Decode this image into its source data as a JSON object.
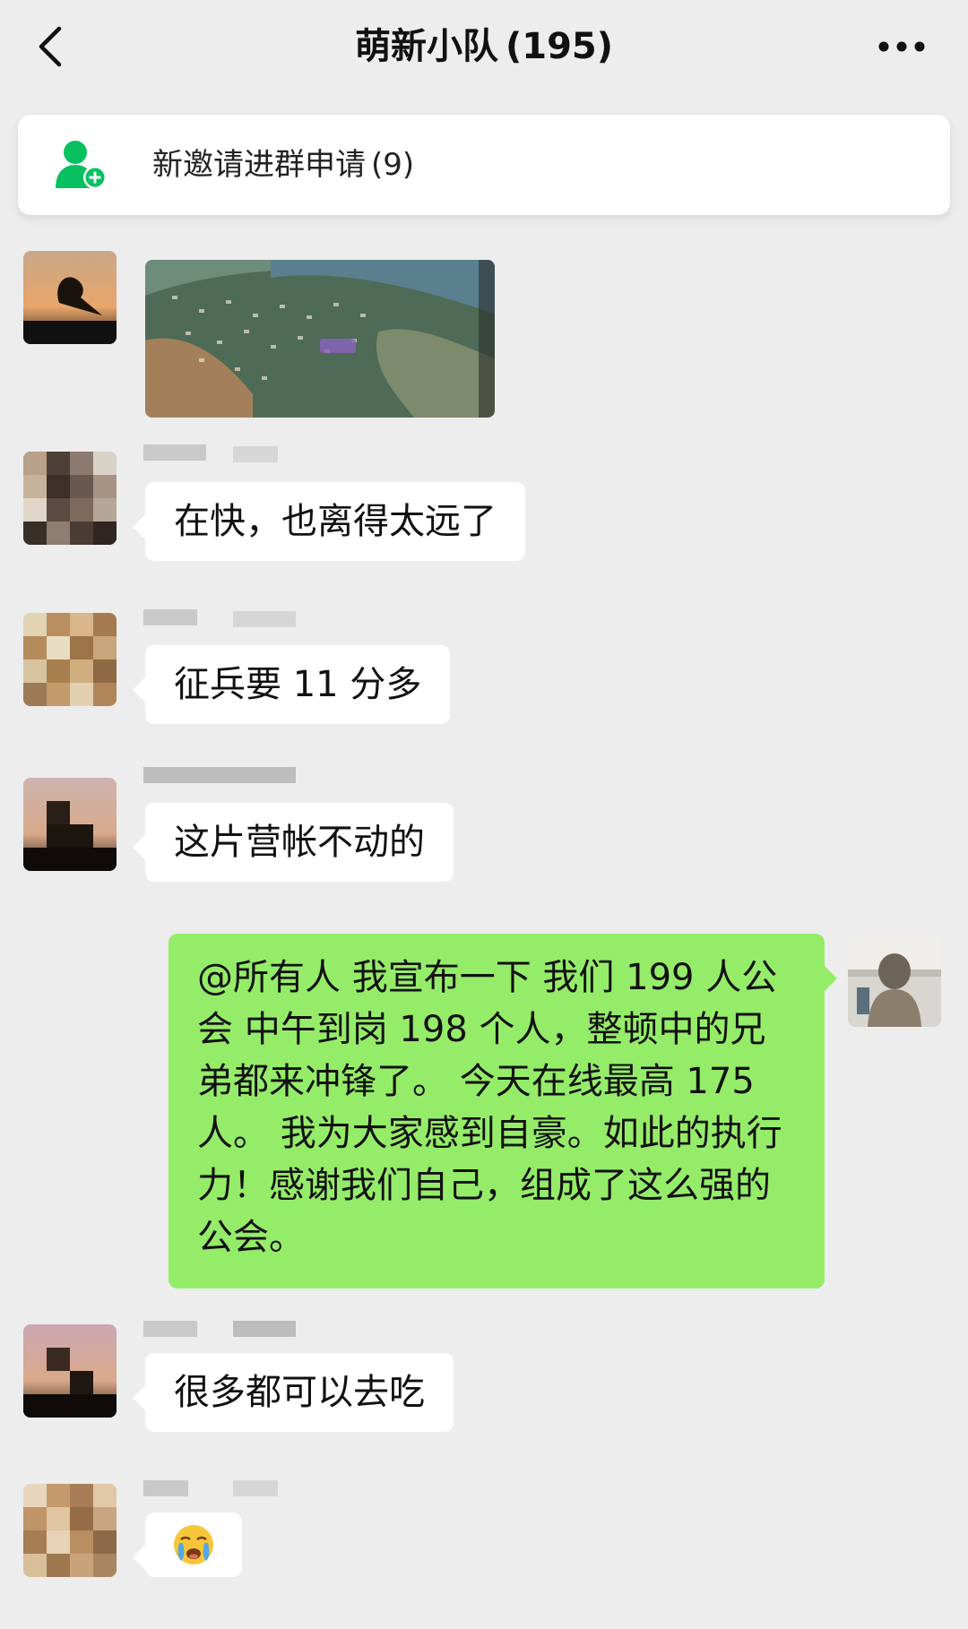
{
  "header": {
    "title": "萌新小队",
    "member_count": "(195)",
    "back_icon": "chevron-left-icon",
    "more_icon": "more-dots-icon"
  },
  "notice": {
    "icon": "add-member-icon",
    "text": "新邀请进群申请",
    "count": "(9)",
    "color": "#07c160"
  },
  "messages": [
    {
      "type": "image",
      "content_desc": "map"
    },
    {
      "type": "text",
      "side": "left",
      "text": "在快，也离得太远了"
    },
    {
      "type": "text",
      "side": "left",
      "text": "征兵要 11 分多"
    },
    {
      "type": "text",
      "side": "left",
      "text": "这片营帐不动的"
    },
    {
      "type": "text",
      "side": "right",
      "text": "@所有人 我宣布一下 我们 199 人公会 中午到岗 198 个人，整顿中的兄弟都来冲锋了。 今天在线最高 175 人。 我为大家感到自豪。如此的执行力！感谢我们自己，组成了这么强的公会。"
    },
    {
      "type": "text",
      "side": "left",
      "text": "很多都可以去吃"
    },
    {
      "type": "emoji",
      "side": "left",
      "text": "😭"
    }
  ],
  "colors": {
    "background": "#ededed",
    "bubble_left": "#ffffff",
    "bubble_right": "#95ec69"
  }
}
